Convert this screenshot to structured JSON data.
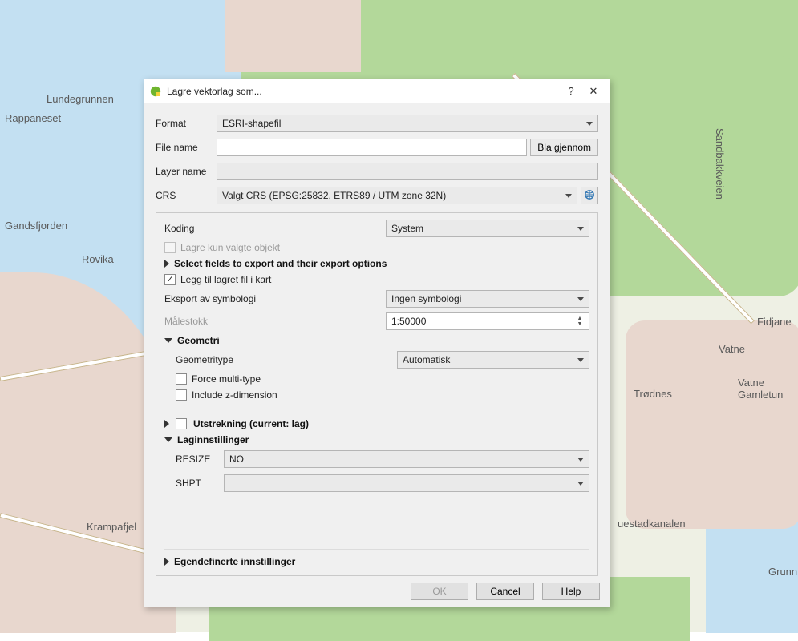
{
  "map": {
    "labels": {
      "lundegrunnen": "Lundegrunnen",
      "rappaneset": "Rappaneset",
      "gandsfjorden": "Gandsfjorden",
      "rovika": "Rovika",
      "krampafjel": "Krampafjel",
      "fidjane": "Fidjane",
      "vatne": "Vatne",
      "vatne_gamletun": "Vatne\nGamletun",
      "trodnes": "Trødnes",
      "uestadkanalen": "uestadkanalen",
      "grunn": "Grunn",
      "sandbakkveien": "Sandbakkveien"
    }
  },
  "dialog": {
    "title": "Lagre vektorlag som...",
    "format_label": "Format",
    "format_value": "ESRI-shapefil",
    "filename_label": "File name",
    "filename_value": "",
    "browse": "Bla gjennom",
    "layername_label": "Layer name",
    "layername_value": "",
    "crs_label": "CRS",
    "crs_value": "Valgt CRS (EPSG:25832, ETRS89 / UTM zone 32N)",
    "koding_label": "Koding",
    "koding_value": "System",
    "chk_selected_only": "Lagre kun valgte objekt",
    "sec_select_fields": "Select fields to export and their export options",
    "chk_add_saved": "Legg til lagret fil i kart",
    "symbology_label": "Eksport av symbologi",
    "symbology_value": "Ingen symbologi",
    "scale_label": "Målestokk",
    "scale_value": "1:50000",
    "sec_geometry": "Geometri",
    "geomtype_label": "Geometritype",
    "geomtype_value": "Automatisk",
    "chk_force_multi": "Force multi-type",
    "chk_include_z": "Include z-dimension",
    "sec_extent": "Utstrekning (current: lag)",
    "sec_layer_settings": "Laginnstillinger",
    "resize_label": "RESIZE",
    "resize_value": "NO",
    "shpt_label": "SHPT",
    "shpt_value": "",
    "sec_custom": "Egendefinerte innstillinger",
    "btn_ok": "OK",
    "btn_cancel": "Cancel",
    "btn_help": "Help"
  }
}
